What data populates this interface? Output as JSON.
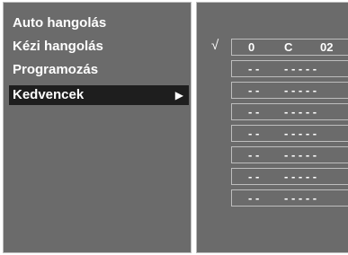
{
  "menu": {
    "items": [
      {
        "label": "Auto hangolás"
      },
      {
        "label": "Kézi hangolás"
      },
      {
        "label": "Programozás"
      },
      {
        "label": "Kedvencek"
      }
    ],
    "selected_arrow": "▶"
  },
  "favorites": {
    "check_mark": "√",
    "slots": [
      {
        "col1": "0",
        "col2": "C",
        "col3": "02"
      },
      {
        "col1": "- -",
        "col2": "- - - - -",
        "col3": ""
      },
      {
        "col1": "- -",
        "col2": "- - - - -",
        "col3": ""
      },
      {
        "col1": "- -",
        "col2": "- - - - -",
        "col3": ""
      },
      {
        "col1": "- -",
        "col2": "- - - - -",
        "col3": ""
      },
      {
        "col1": "- -",
        "col2": "- - - - -",
        "col3": ""
      },
      {
        "col1": "- -",
        "col2": "- - - - -",
        "col3": ""
      },
      {
        "col1": "- -",
        "col2": "- - - - -",
        "col3": ""
      }
    ]
  }
}
